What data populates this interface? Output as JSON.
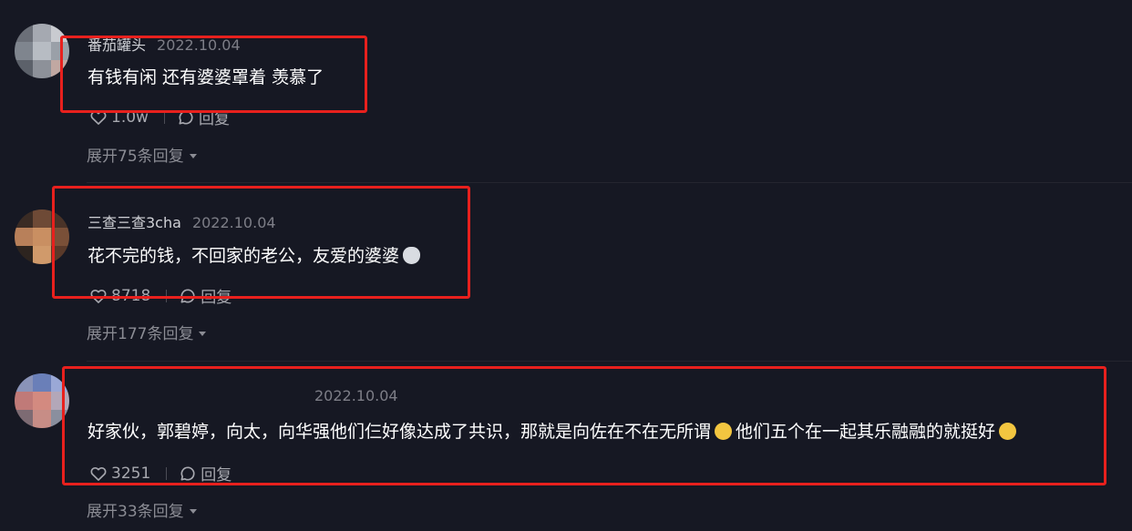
{
  "comments": [
    {
      "username": "番茄罐头",
      "date": "2022.10.04",
      "text": "有钱有闲 还有婆婆罩着 羡慕了",
      "likes": "1.0w",
      "reply_label": "回复",
      "expand_label": "展开75条回复"
    },
    {
      "username": "三查三查3cha",
      "date": "2022.10.04",
      "text": "花不完的钱，不回家的老公，友爱的婆婆",
      "likes": "8718",
      "reply_label": "回复",
      "expand_label": "展开177条回复"
    },
    {
      "username": "",
      "date": "2022.10.04",
      "text_part1": "好家伙，郭碧婷，向太，向华强他们仨好像达成了共识，那就是向佐在不在无所谓",
      "text_part2": "他们五个在一起其乐融融的就挺好",
      "likes": "3251",
      "reply_label": "回复",
      "expand_label": "展开33条回复"
    }
  ],
  "icons": {
    "like": "heart-outline-icon",
    "reply": "speech-bubble-icon",
    "expand": "caret-down-icon",
    "emoji_laugh": "laughing-tears-emoji",
    "emoji_cat": "cat-face-emoji"
  },
  "colors": {
    "background": "#161823",
    "highlight_box": "#e8201d",
    "text_primary": "#ffffff",
    "text_secondary": "#7d7e87"
  }
}
